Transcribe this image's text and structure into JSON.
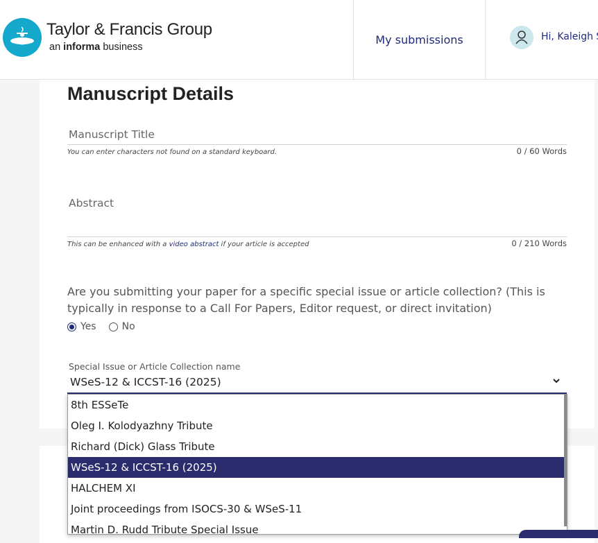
{
  "header": {
    "brand_name": "Taylor & Francis Group",
    "brand_sub_prefix": "an ",
    "brand_sub_bold": "informa",
    "brand_sub_suffix": " business",
    "nav_my_submissions": "My submissions",
    "greeting": "Hi, Kaleigh Su",
    "logo_color": "#14a8cc",
    "avatar_icon": "user-icon"
  },
  "form": {
    "section_title": "Manuscript Details",
    "title_field": {
      "placeholder": "Manuscript Title",
      "hint": "You can enter characters not found on a standard keyboard.",
      "counter": "0 / 60 Words"
    },
    "abstract_field": {
      "placeholder": "Abstract",
      "hint_prefix": "This can be enhanced with a ",
      "hint_link": "video abstract",
      "hint_suffix": " if your article is accepted",
      "counter": "0 / 210 Words"
    },
    "special_issue_question": "Are you submitting your paper for a specific special issue or article collection? (This is typically in response to a Call For Papers, Editor request, or direct invitation)",
    "radio_yes": "Yes",
    "radio_no": "No",
    "radio_selected": "Yes",
    "collection_label": "Special Issue or Article Collection name",
    "collection_value": "WSeS-12 & ICCST-16 (2025)",
    "collection_options": [
      "8th ESSeTe",
      "Oleg I. Kolodyazhny Tribute",
      "Richard (Dick) Glass Tribute",
      "WSeS-12 & ICCST-16 (2025)",
      "HALCHEM XI",
      "Joint proceedings from ISOCS-30 & WSeS-11",
      "Martin D. Rudd Tribute Special Issue"
    ],
    "accent_color": "#2a2c6e"
  }
}
